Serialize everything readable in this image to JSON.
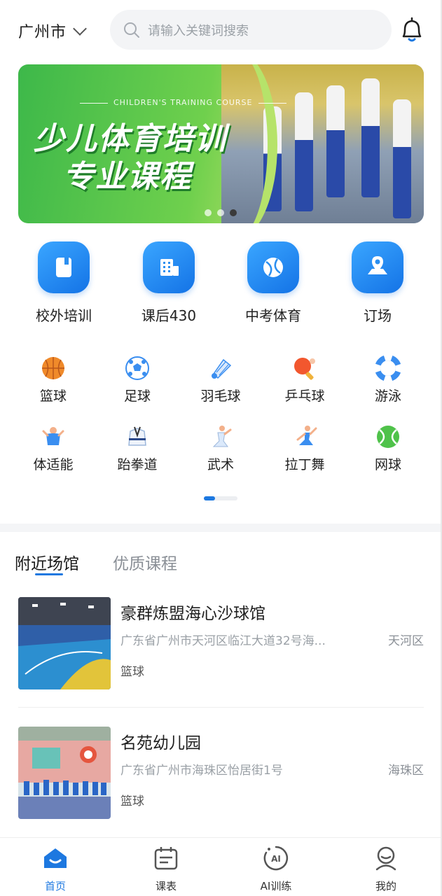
{
  "header": {
    "city": "广州市",
    "search_placeholder": "请输入关键词搜索"
  },
  "banner": {
    "subtitle": "CHILDREN'S TRAINING COURSE",
    "title_line1": "少儿体育培训",
    "title_line2": "专业课程",
    "slides": 3,
    "active_slide": 3
  },
  "main_categories": [
    {
      "label": "校外培训",
      "icon": "book-icon"
    },
    {
      "label": "课后430",
      "icon": "building-icon"
    },
    {
      "label": "中考体育",
      "icon": "ball-icon"
    },
    {
      "label": "订场",
      "icon": "location-map-icon"
    }
  ],
  "sports": [
    {
      "label": "篮球",
      "icon": "basketball-icon"
    },
    {
      "label": "足球",
      "icon": "football-icon"
    },
    {
      "label": "羽毛球",
      "icon": "shuttlecock-icon"
    },
    {
      "label": "乒乓球",
      "icon": "ping-pong-icon"
    },
    {
      "label": "游泳",
      "icon": "lifebuoy-icon"
    },
    {
      "label": "体适能",
      "icon": "fitness-icon"
    },
    {
      "label": "跆拳道",
      "icon": "taekwondo-icon"
    },
    {
      "label": "武术",
      "icon": "martial-arts-icon"
    },
    {
      "label": "拉丁舞",
      "icon": "latin-dance-icon"
    },
    {
      "label": "网球",
      "icon": "tennis-icon"
    }
  ],
  "sports_pager": {
    "pages": 2,
    "active": 1
  },
  "tabs": [
    {
      "label": "附近场馆",
      "active": true
    },
    {
      "label": "优质课程",
      "active": false
    }
  ],
  "venues": [
    {
      "name": "豪群炼盟海心沙球馆",
      "address": "广东省广州市天河区临江大道32号海...",
      "district": "天河区",
      "tag": "篮球"
    },
    {
      "name": "名苑幼儿园",
      "address": "广东省广州市海珠区怡居街1号",
      "district": "海珠区",
      "tag": "篮球"
    }
  ],
  "bottom_nav": [
    {
      "label": "首页",
      "icon": "home-icon",
      "active": true
    },
    {
      "label": "课表",
      "icon": "schedule-icon",
      "active": false
    },
    {
      "label": "AI训练",
      "icon": "ai-icon",
      "active": false
    },
    {
      "label": "我的",
      "icon": "profile-icon",
      "active": false
    }
  ],
  "colors": {
    "accent": "#1d78e0",
    "banner_green": "#4cc24e"
  }
}
